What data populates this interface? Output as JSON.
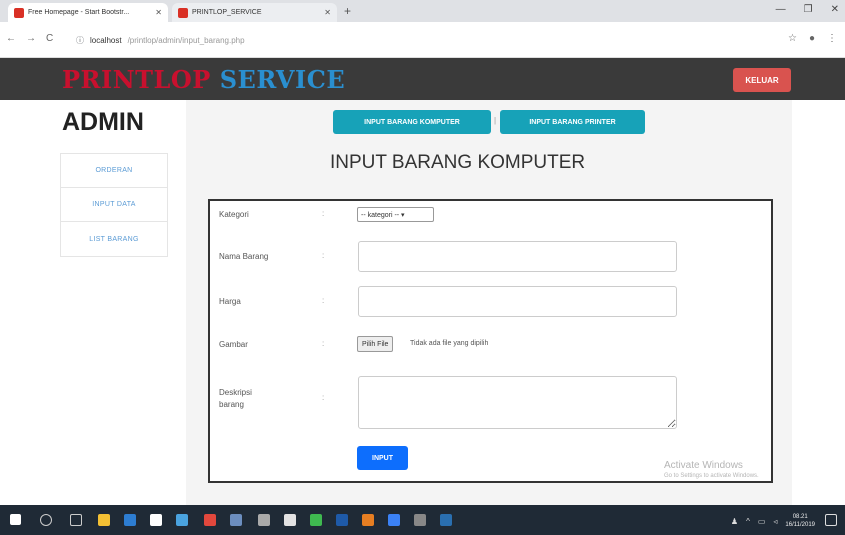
{
  "browser": {
    "tabs": [
      {
        "title": "Free Homepage - Start Bootstr..."
      },
      {
        "title": "PRINTLOP_SERVICE"
      }
    ],
    "url_host": "localhost",
    "url_path": "/printlop/admin/input_barang.php"
  },
  "navbar": {
    "brand_part1": "PRINTLOP",
    "brand_part2": "SERVICE",
    "logout_label": "KELUAR"
  },
  "sidebar": {
    "heading": "ADMIN",
    "items": [
      {
        "label": "ORDERAN"
      },
      {
        "label": "INPUT DATA"
      },
      {
        "label": "LIST BARANG"
      }
    ]
  },
  "main": {
    "tab_buttons": [
      {
        "label": "INPUT BARANG KOMPUTER"
      },
      {
        "label": "INPUT BARANG PRINTER"
      }
    ],
    "separator": "|",
    "title": "INPUT BARANG KOMPUTER",
    "form": {
      "colon": ":",
      "kategori_label": "Kategori",
      "kategori_value": "-- kategori -- ▾",
      "nama_label": "Nama Barang",
      "nama_value": "",
      "harga_label": "Harga",
      "harga_value": "",
      "gambar_label": "Gambar",
      "file_button": "Pilih File",
      "file_status": "Tidak ada file yang dipilih",
      "deskripsi_label_1": "Deskripsi",
      "deskripsi_label_2": "barang",
      "submit_label": "INPUT"
    }
  },
  "watermark": {
    "line1": "Activate Windows",
    "line2": "Go to Settings to activate Windows."
  },
  "taskbar": {
    "time": "08.21",
    "date": "16/11/2019"
  },
  "colors": {
    "navbar_bg": "#3a3a3a",
    "brand_red": "#c8102e",
    "brand_blue": "#2a8fd0",
    "logout_red": "#d9534f",
    "teal": "#17a2b8",
    "primary_blue": "#0d6efd"
  }
}
